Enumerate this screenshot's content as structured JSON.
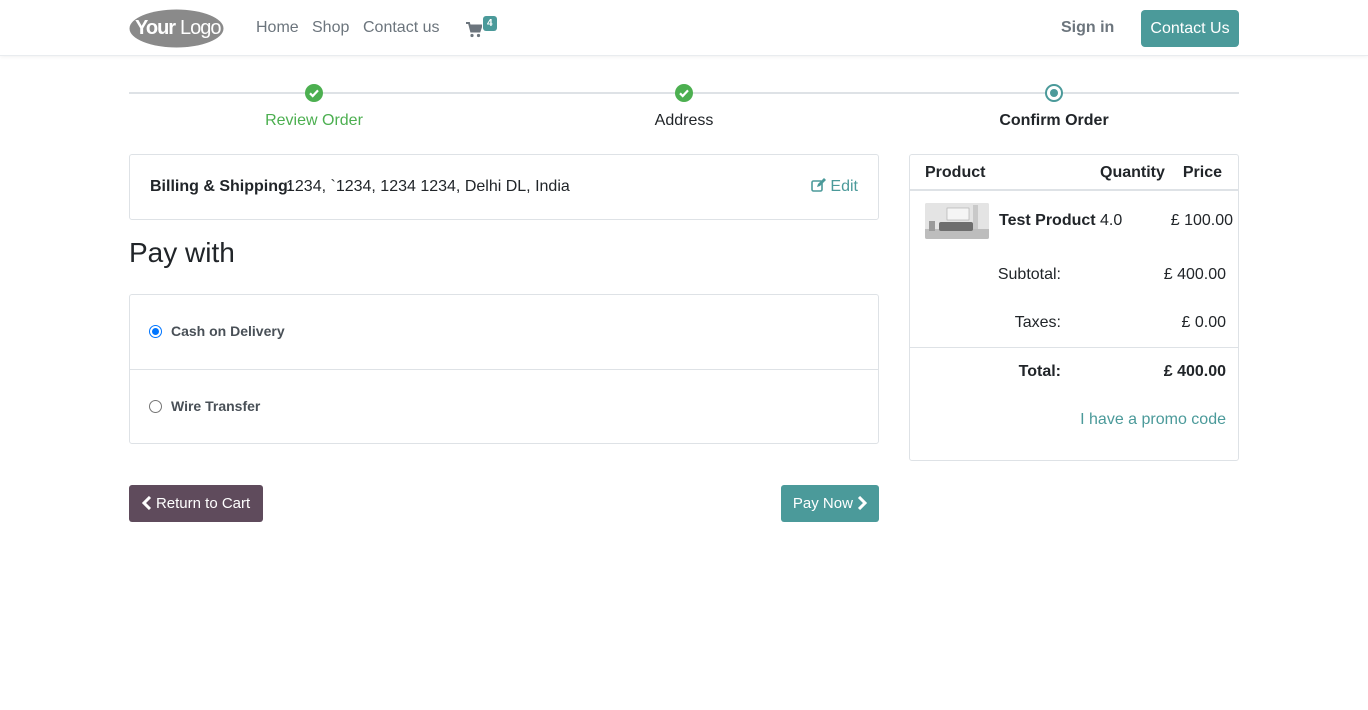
{
  "header": {
    "logo_text": "YourLogo",
    "nav": [
      "Home",
      "Shop",
      "Contact us"
    ],
    "cart_count": "4",
    "signin_label": "Sign in",
    "contact_button": "Contact Us"
  },
  "progress": {
    "steps": [
      {
        "label": "Review Order",
        "state": "done"
      },
      {
        "label": "Address",
        "state": "done"
      },
      {
        "label": "Confirm Order",
        "state": "current"
      }
    ]
  },
  "billing": {
    "label": "Billing & Shipping:",
    "address": "1234, `1234, 1234 1234, Delhi DL, India",
    "edit_label": "Edit"
  },
  "payment": {
    "title": "Pay with",
    "options": [
      {
        "label": "Cash on Delivery",
        "selected": true
      },
      {
        "label": "Wire Transfer",
        "selected": false
      }
    ]
  },
  "actions": {
    "return_label": "Return to Cart",
    "pay_label": "Pay Now"
  },
  "summary": {
    "headers": {
      "product": "Product",
      "quantity": "Quantity",
      "price": "Price"
    },
    "items": [
      {
        "name": "Test Product",
        "quantity": "4.0",
        "price": "£ 100.00"
      }
    ],
    "subtotal_label": "Subtotal:",
    "subtotal": "£ 400.00",
    "taxes_label": "Taxes:",
    "taxes": "£ 0.00",
    "total_label": "Total:",
    "total": "£ 400.00",
    "promo_label": "I have a promo code"
  },
  "colors": {
    "accent": "#4b9a9a",
    "success": "#4caf50",
    "secondary_button": "#5f4b5c"
  }
}
